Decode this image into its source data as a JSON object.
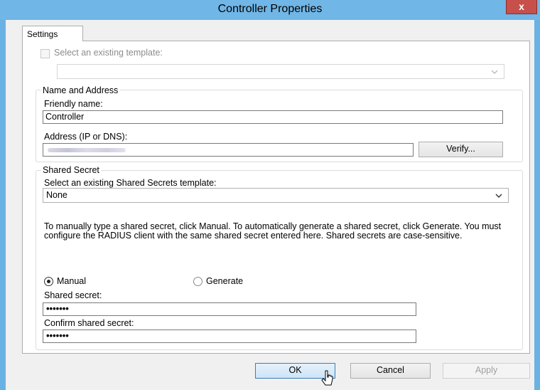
{
  "window": {
    "title": "Controller Properties",
    "close_label": "x"
  },
  "tabs": [
    {
      "label": "Settings"
    }
  ],
  "template": {
    "checkbox_label": "Select an existing template:",
    "value": ""
  },
  "name_address": {
    "group_title": "Name and Address",
    "friendly_name_label": "Friendly name:",
    "friendly_name_value": "Controller",
    "address_label": "Address (IP or DNS):",
    "address_value": "",
    "verify_label": "Verify..."
  },
  "shared_secret": {
    "group_title": "Shared Secret",
    "template_label": "Select an existing Shared Secrets template:",
    "template_value": "None",
    "description": "To manually type a shared secret, click Manual. To automatically generate a shared secret, click Generate. You must configure the RADIUS client with the same shared secret entered here. Shared secrets are case-sensitive.",
    "radio_manual": "Manual",
    "radio_generate": "Generate",
    "selected_mode": "Manual",
    "secret_label": "Shared secret:",
    "secret_value": "•••••••",
    "confirm_label": "Confirm shared secret:",
    "confirm_value": "•••••••"
  },
  "footer": {
    "ok_label": "OK",
    "cancel_label": "Cancel",
    "apply_label": "Apply"
  },
  "colors": {
    "title_bar": "#70b6e6",
    "close_button": "#c7504a",
    "primary_button_border": "#3c7fb1"
  }
}
